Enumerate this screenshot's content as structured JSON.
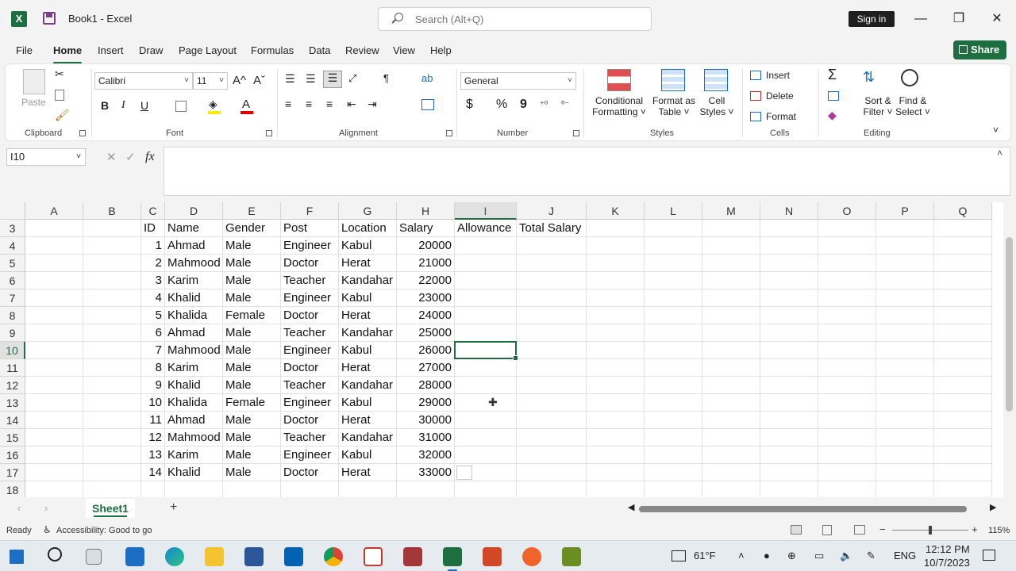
{
  "titlebar": {
    "app_icon": "excel-logo-icon",
    "app_letter": "X",
    "document_title": "Book1  -  Excel",
    "search_placeholder": "Search (Alt+Q)",
    "sign_in": "Sign in",
    "minimize": "—",
    "restore": "❐",
    "close": "✕"
  },
  "menu_tabs": [
    "File",
    "Home",
    "Insert",
    "Draw",
    "Page Layout",
    "Formulas",
    "Data",
    "Review",
    "View",
    "Help"
  ],
  "active_tab": "Home",
  "share_label": "Share",
  "ribbon": {
    "clipboard": {
      "paste": "Paste",
      "label": "Clipboard"
    },
    "font": {
      "name": "Calibri",
      "size": "11",
      "grow": "A^",
      "shrink": "Aˇ",
      "bold": "B",
      "italic": "I",
      "underline": "U",
      "label": "Font"
    },
    "alignment": {
      "label": "Alignment"
    },
    "number": {
      "format": "General",
      "currency": "$",
      "percent": "%",
      "comma": "9",
      "label": "Number"
    },
    "styles": {
      "conditional": [
        "Conditional",
        "Formatting ˅"
      ],
      "format_table": [
        "Format as",
        "Table ˅"
      ],
      "cell_styles": [
        "Cell",
        "Styles ˅"
      ],
      "label": "Styles"
    },
    "cells": {
      "insert": "Insert",
      "delete": "Delete",
      "format": "Format",
      "label": "Cells"
    },
    "editing": {
      "sort": [
        "Sort &",
        "Filter ˅"
      ],
      "find": [
        "Find &",
        "Select ˅"
      ],
      "label": "Editing"
    }
  },
  "formula_bar": {
    "name_box": "I10",
    "fx": "fx",
    "value": ""
  },
  "columns": [
    "A",
    "B",
    "C",
    "D",
    "E",
    "F",
    "G",
    "H",
    "I",
    "J",
    "K",
    "L",
    "M",
    "N",
    "O",
    "P",
    "Q"
  ],
  "selected_column": "I",
  "selected_row": "10",
  "rows": [
    "3",
    "4",
    "5",
    "6",
    "7",
    "8",
    "9",
    "10",
    "11",
    "12",
    "13",
    "14",
    "15",
    "16",
    "17",
    "18"
  ],
  "headers": {
    "C": "ID",
    "D": "Name",
    "E": "Gender",
    "F": "Post",
    "G": "Location",
    "H": "Salary",
    "I": "Allowance",
    "J": "Total Salary"
  },
  "table": [
    [
      "1",
      "Ahmad",
      "Male",
      "Engineer",
      "Kabul",
      "20000"
    ],
    [
      "2",
      "Mahmood",
      "Male",
      "Doctor",
      "Herat",
      "21000"
    ],
    [
      "3",
      "Karim",
      "Male",
      "Teacher",
      "Kandahar",
      "22000"
    ],
    [
      "4",
      "Khalid",
      "Male",
      "Engineer",
      "Kabul",
      "23000"
    ],
    [
      "5",
      "Khalida",
      "Female",
      "Doctor",
      "Herat",
      "24000"
    ],
    [
      "6",
      "Ahmad",
      "Male",
      "Teacher",
      "Kandahar",
      "25000"
    ],
    [
      "7",
      "Mahmood",
      "Male",
      "Engineer",
      "Kabul",
      "26000"
    ],
    [
      "8",
      "Karim",
      "Male",
      "Doctor",
      "Herat",
      "27000"
    ],
    [
      "9",
      "Khalid",
      "Male",
      "Teacher",
      "Kandahar",
      "28000"
    ],
    [
      "10",
      "Khalida",
      "Female",
      "Engineer",
      "Kabul",
      "29000"
    ],
    [
      "11",
      "Ahmad",
      "Male",
      "Doctor",
      "Herat",
      "30000"
    ],
    [
      "12",
      "Mahmood",
      "Male",
      "Teacher",
      "Kandahar",
      "31000"
    ],
    [
      "13",
      "Karim",
      "Male",
      "Engineer",
      "Kabul",
      "32000"
    ],
    [
      "14",
      "Khalid",
      "Male",
      "Doctor",
      "Herat",
      "33000"
    ]
  ],
  "sheet": {
    "name": "Sheet1",
    "add": "+"
  },
  "status": {
    "ready": "Ready",
    "accessibility": "Accessibility: Good to go",
    "zoom": "115%",
    "zoom_minus": "−",
    "zoom_plus": "+"
  },
  "taskbar": {
    "weather": "61°F",
    "language": "ENG",
    "time": "12:12 PM",
    "date": "10/7/2023"
  },
  "colors": {
    "excel_green": "#1d6f42",
    "selection": "#1d6f42"
  }
}
